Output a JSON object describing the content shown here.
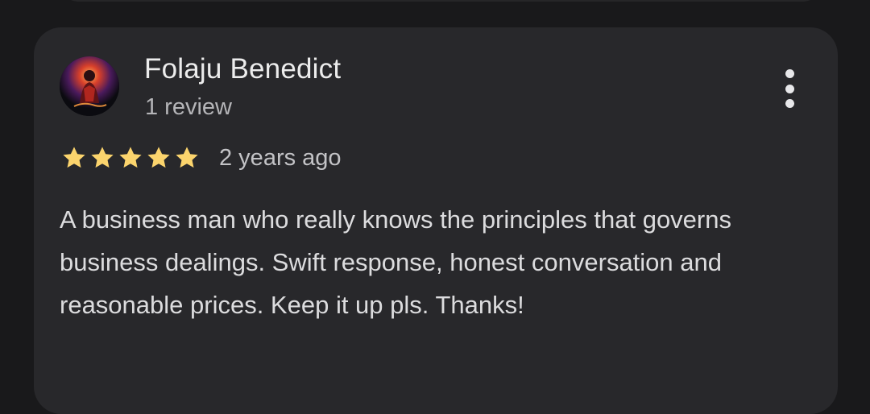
{
  "review": {
    "author": {
      "name": "Folaju Benedict",
      "review_count": "1 review",
      "avatar_icon": "profile-photo-icon"
    },
    "rating": 5,
    "rating_max": 5,
    "time_ago": "2 years ago",
    "text": "A business man who really knows the principles that governs business dealings. Swift response, honest conversation and reasonable prices. Keep it up pls. Thanks!",
    "more_icon": "more-vert-icon"
  },
  "colors": {
    "background": "#19191b",
    "card": "#28282b",
    "star": "#fbd46d",
    "text_primary": "#ececec",
    "text_secondary": "#b5b5b8"
  }
}
